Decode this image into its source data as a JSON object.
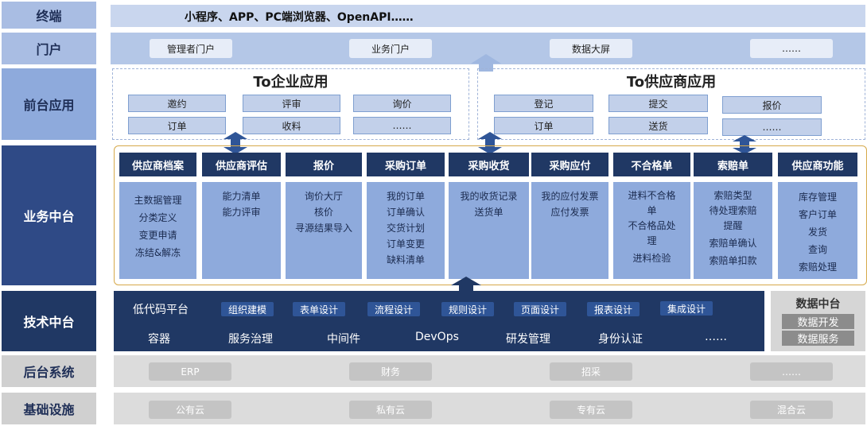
{
  "rows": {
    "terminal": {
      "label": "终端",
      "content": "小程序、APP、PC端浏览器、OpenAPI……"
    },
    "portal": {
      "label": "门户",
      "items": [
        "管理者门户",
        "业务门户",
        "数据大屏",
        "……"
      ]
    },
    "frontend": {
      "label": "前台应用",
      "enterprise": {
        "title": "To企业应用",
        "items": [
          "邀约",
          "评审",
          "询价",
          "订单",
          "收料",
          "……"
        ]
      },
      "supplier": {
        "title": "To供应商应用",
        "items": [
          "登记",
          "提交",
          "报价",
          "订单",
          "送货",
          "……"
        ]
      }
    },
    "business": {
      "label": "业务中台",
      "columns": [
        {
          "title": "供应商档案",
          "items": [
            "主数据管理",
            "分类定义",
            "变更申请",
            "冻结&解冻"
          ]
        },
        {
          "title": "供应商评估",
          "items": [
            "能力清单",
            "能力评审"
          ]
        },
        {
          "title": "报价",
          "items": [
            "询价大厅",
            "核价",
            "寻源结果导入"
          ]
        },
        {
          "title": "采购订单",
          "items": [
            "我的订单",
            "订单确认",
            "交货计划",
            "订单变更",
            "缺料清单"
          ]
        },
        {
          "title": "采购收货",
          "items": [
            "我的收货记录",
            "送货单"
          ]
        },
        {
          "title": "采购应付",
          "items": [
            "我的应付发票",
            "应付发票"
          ]
        },
        {
          "title": "不合格单",
          "items": [
            "进料不合格",
            "单",
            "不合格品处",
            "理",
            "进料检验"
          ]
        },
        {
          "title": "索赔单",
          "items": [
            "索赔类型",
            "待处理索赔",
            "提醒",
            "索赔单确认",
            "索赔单扣款"
          ]
        },
        {
          "title": "供应商功能",
          "items": [
            "库存管理",
            "客户订单",
            "发货",
            "查询",
            "索赔处理"
          ]
        }
      ]
    },
    "tech": {
      "label": "技术中台",
      "row1_title": "低代码平台",
      "row1_items": [
        "组织建模",
        "表单设计",
        "流程设计",
        "规则设计",
        "页面设计",
        "报表设计",
        "集成设计"
      ],
      "row2_items": [
        "容器",
        "服务治理",
        "中间件",
        "DevOps",
        "研发管理",
        "身份认证",
        "……"
      ],
      "data": {
        "title": "数据中台",
        "items": [
          "数据开发",
          "数据服务"
        ]
      }
    },
    "backend": {
      "label": "后台系统",
      "items": [
        "ERP",
        "财务",
        "招采",
        "……"
      ]
    },
    "infra": {
      "label": "基础设施",
      "items": [
        "公有云",
        "私有云",
        "专有云",
        "混合云"
      ]
    }
  },
  "colors": {
    "navy": "#203864",
    "mid_blue": "#8eaadc",
    "light_band": "#c9d6ee",
    "label_light": "#a9bde3",
    "label_dark": "#2f4a86",
    "gray_band": "#dcdcdc",
    "gold_border": "#d6a94a"
  }
}
